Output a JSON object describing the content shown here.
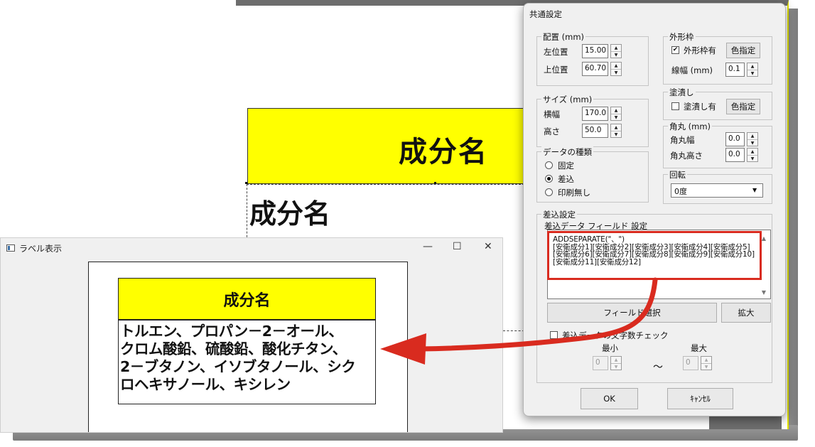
{
  "background_label": {
    "header_text": "成分名",
    "body_text": "成分名"
  },
  "label_window": {
    "title": "ラベル表示",
    "minimize": "—",
    "maximize": "☐",
    "close": "✕",
    "header_text": "成分名",
    "body_lines": [
      "トルエン、プロパン－2－オール、",
      "クロム酸鉛、硫酸鉛、酸化チタン、",
      "2－ブタノン、イソブタノール、シク",
      "ロヘキサノール、キシレン"
    ]
  },
  "dialog": {
    "title": "共通設定",
    "placement": {
      "group": "配置 (mm)",
      "left_label": "左位置",
      "left_value": "15.00",
      "top_label": "上位置",
      "top_value": "60.70"
    },
    "size": {
      "group": "サイズ (mm)",
      "width_label": "横幅",
      "width_value": "170.0",
      "height_label": "高さ",
      "height_value": "50.0"
    },
    "data_type": {
      "group": "データの種類",
      "options": [
        "固定",
        "差込",
        "印刷無し"
      ],
      "selected": "差込"
    },
    "outer_frame": {
      "group": "外形枠",
      "checkbox_label": "外形枠有",
      "checked": true,
      "color_button": "色指定",
      "line_width_label": "線幅 (mm)",
      "line_width_value": "0.1"
    },
    "fill": {
      "group": "塗潰し",
      "checkbox_label": "塗潰し有",
      "checked": false,
      "color_button": "色指定"
    },
    "corner": {
      "group": "角丸 (mm)",
      "width_label": "角丸幅",
      "width_value": "0.0",
      "height_label": "角丸高さ",
      "height_value": "0.0"
    },
    "rotation": {
      "group": "回転",
      "value": "0度"
    },
    "merge": {
      "group": "差込設定",
      "field_label": "差込データ フィールド 設定",
      "field_text": "ADDSEPARATE(\"、\")\n[安衛成分1][安衛成分2][安衛成分3][安衛成分4][安衛成分5][安衛成分6][安衛成分7][安衛成分8][安衛成分9][安衛成分10][安衛成分11][安衛成分12]",
      "field_select_button": "フィールド選択",
      "expand_button": "拡大",
      "char_check_label": "差込データの文字数チェック",
      "char_check_checked": false,
      "min_label": "最小",
      "min_value": "0",
      "range_sep": "～",
      "max_label": "最大",
      "max_value": "0"
    },
    "ok_button": "OK",
    "cancel_button": "ｷｬﾝｾﾙ"
  },
  "colors": {
    "label_yellow": "#ffff00",
    "highlight_red": "#d92b1f"
  }
}
